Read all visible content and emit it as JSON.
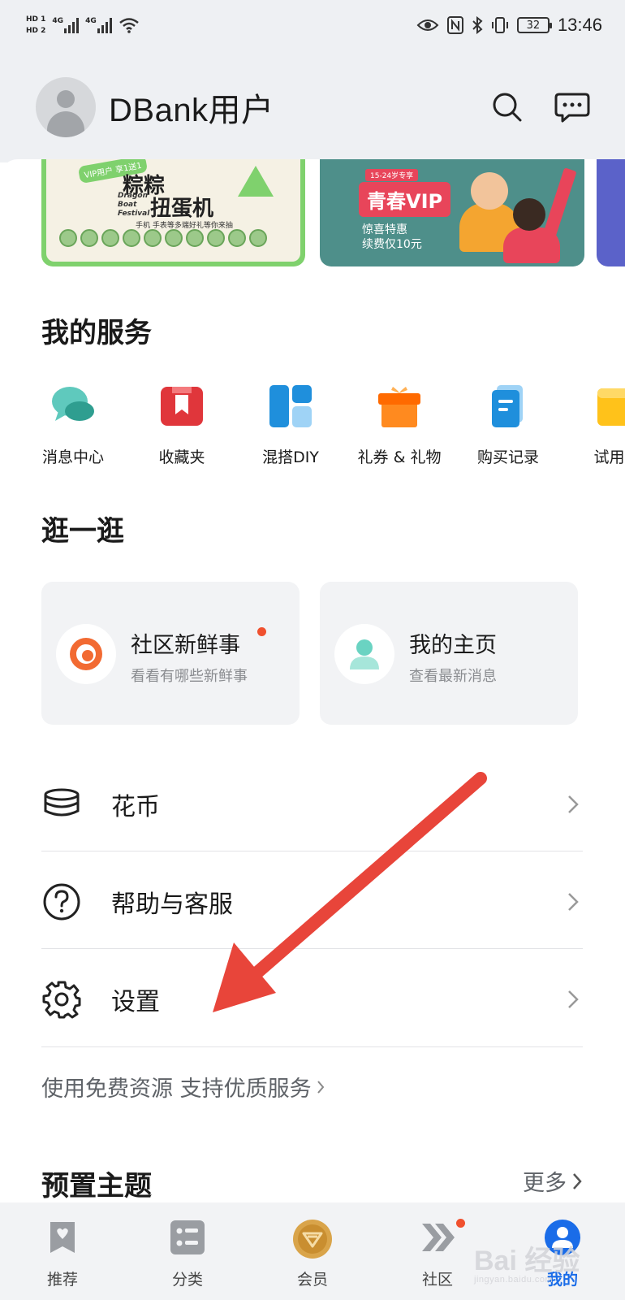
{
  "status_bar": {
    "hd1": "HD 1",
    "hd2": "HD 2",
    "net1": "4G",
    "net2": "4G",
    "battery": "32",
    "time": "13:46"
  },
  "header": {
    "username": "DBank用户"
  },
  "banners": [
    {
      "tag": "VIP用户\n享1送1",
      "title_line1": "粽粽",
      "title_line2": "扭蛋机",
      "en": "Dragon\nBoat\nFestival",
      "sub": "手机 手表等多端好礼等你来抽",
      "accent": "#7fd16d"
    },
    {
      "top": "15-24岁专享",
      "title": "青春VIP",
      "sub1": "惊喜特惠",
      "sub2": "续费仅10元",
      "accent": "#4e8f8a"
    }
  ],
  "services": {
    "title": "我的服务",
    "items": [
      {
        "label": "消息中心",
        "icon": "chat-bubble-icon"
      },
      {
        "label": "收藏夹",
        "icon": "bookmark-icon"
      },
      {
        "label": "混搭DIY",
        "icon": "mix-diy-icon"
      },
      {
        "label": "礼券 & 礼物",
        "icon": "gift-icon"
      },
      {
        "label": "购买记录",
        "icon": "receipt-icon"
      },
      {
        "label": "试用主",
        "icon": "trial-icon"
      }
    ]
  },
  "stroll": {
    "title": "逛一逛",
    "cards": [
      {
        "title": "社区新鲜事",
        "subtitle": "看看有哪些新鲜事"
      },
      {
        "title": "我的主页",
        "subtitle": "查看最新消息"
      }
    ]
  },
  "list": {
    "items": [
      {
        "label": "花币",
        "icon": "coins-icon"
      },
      {
        "label": "帮助与客服",
        "icon": "help-icon"
      },
      {
        "label": "设置",
        "icon": "gear-icon"
      }
    ]
  },
  "promo": {
    "text": "使用免费资源 支持优质服务"
  },
  "themes": {
    "title": "预置主题",
    "more": "更多"
  },
  "bottom_nav": {
    "items": [
      {
        "label": "推荐",
        "icon": "recommend-icon"
      },
      {
        "label": "分类",
        "icon": "category-icon"
      },
      {
        "label": "会员",
        "icon": "member-icon"
      },
      {
        "label": "社区",
        "icon": "community-icon"
      },
      {
        "label": "我的",
        "icon": "me-icon",
        "active": true
      }
    ]
  },
  "watermark": {
    "text": "Bai 经验",
    "sub": "jingyan.baidu.com"
  },
  "colors": {
    "accent_blue": "#1a6ce8",
    "red_dot": "#f0502e",
    "arrow": "#e8453a"
  }
}
